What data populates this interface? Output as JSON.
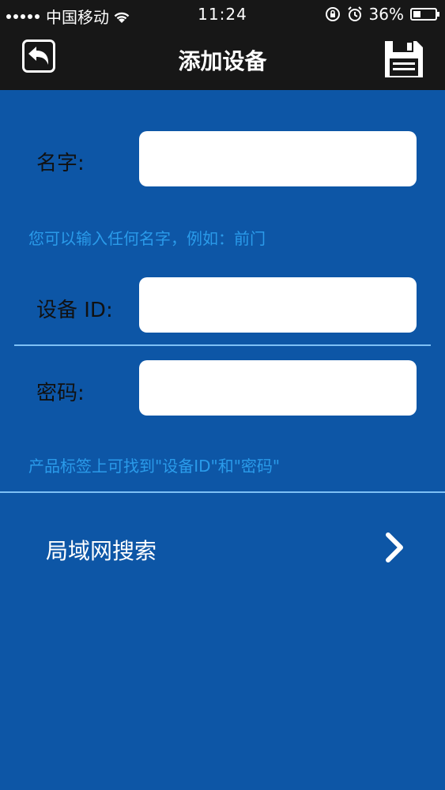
{
  "status_bar": {
    "carrier": "中国移动",
    "time": "11:24",
    "battery": "36%",
    "battery_level": 0.36
  },
  "nav": {
    "title": "添加设备"
  },
  "form": {
    "name_label": "名字:",
    "name_value": "",
    "name_hint": "您可以输入任何名字，例如：前门",
    "device_id_label": "设备 ID:",
    "device_id_value": "",
    "password_label": "密码:",
    "password_value": "",
    "credentials_hint": "产品标签上可找到\"设备ID\"和\"密码\""
  },
  "lan_search": {
    "label": "局域网搜索"
  },
  "icons": {
    "back": "back-arrow-icon",
    "save": "floppy-disk-icon",
    "chevron": "chevron-right-icon",
    "wifi": "wifi-icon",
    "lock_rotation": "rotation-lock-icon",
    "alarm": "alarm-clock-icon",
    "battery": "battery-icon"
  },
  "colors": {
    "background": "#0d56a6",
    "bar": "#171717",
    "hint": "#2a9bea",
    "divider": "#7ec0f5"
  }
}
